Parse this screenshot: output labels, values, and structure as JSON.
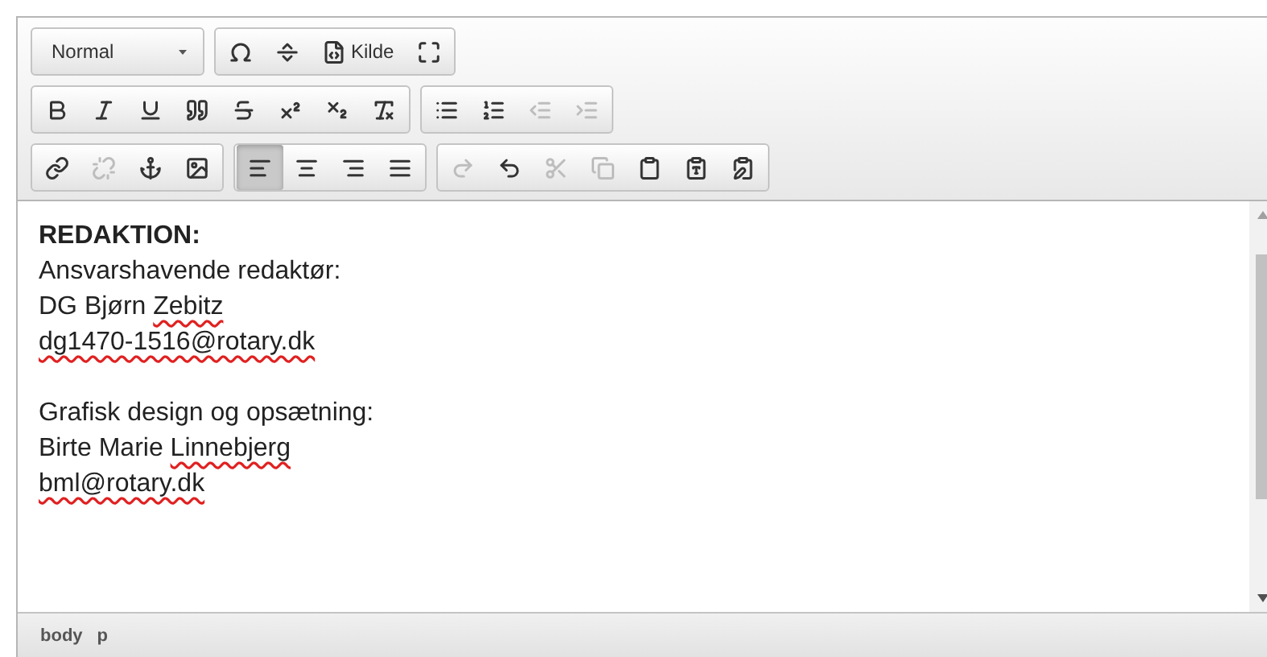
{
  "toolbar": {
    "rows": [
      [
        {
          "kind": "format",
          "label": "Normal"
        },
        {
          "buttons": [
            {
              "kind": "omega",
              "disabled": false
            },
            {
              "kind": "pagebreak",
              "disabled": false
            },
            {
              "kind": "source",
              "label": "Kilde",
              "disabled": false
            },
            {
              "kind": "maximize",
              "disabled": false
            }
          ]
        }
      ],
      [
        {
          "buttons": [
            {
              "kind": "bold",
              "disabled": false
            },
            {
              "kind": "italic",
              "disabled": false
            },
            {
              "kind": "underline",
              "disabled": false
            },
            {
              "kind": "quote",
              "disabled": false
            },
            {
              "kind": "strike",
              "disabled": false
            },
            {
              "kind": "superscript",
              "disabled": false
            },
            {
              "kind": "subscript",
              "disabled": false
            },
            {
              "kind": "removeformat",
              "disabled": false
            }
          ]
        },
        {
          "buttons": [
            {
              "kind": "bulletlist",
              "disabled": false
            },
            {
              "kind": "numberlist",
              "disabled": false
            },
            {
              "kind": "outdent",
              "disabled": true
            },
            {
              "kind": "indent",
              "disabled": true
            }
          ]
        }
      ],
      [
        {
          "buttons": [
            {
              "kind": "link",
              "disabled": false
            },
            {
              "kind": "unlink",
              "disabled": true
            },
            {
              "kind": "anchor",
              "disabled": false
            },
            {
              "kind": "image",
              "disabled": false
            }
          ]
        },
        {
          "buttons": [
            {
              "kind": "alignleft",
              "disabled": false,
              "selected": true
            },
            {
              "kind": "aligncenter",
              "disabled": false,
              "selected": false
            },
            {
              "kind": "alignright",
              "disabled": false,
              "selected": false
            },
            {
              "kind": "justify",
              "disabled": false,
              "selected": false
            }
          ]
        },
        {
          "buttons": [
            {
              "kind": "redo",
              "disabled": true
            },
            {
              "kind": "undo",
              "disabled": false
            },
            {
              "kind": "cut",
              "disabled": true
            },
            {
              "kind": "copy",
              "disabled": true
            },
            {
              "kind": "paste",
              "disabled": false
            },
            {
              "kind": "pastetext",
              "disabled": false
            },
            {
              "kind": "pasteword",
              "disabled": false
            }
          ]
        }
      ]
    ]
  },
  "content": {
    "paragraphs": [
      [
        [
          {
            "text": "REDAKTION:",
            "kind": "bold"
          }
        ],
        [
          {
            "text": "Ansvarshavende redaktør:",
            "kind": "plain"
          }
        ],
        [
          {
            "text": "DG Bjørn ",
            "kind": "plain"
          },
          {
            "text": "Zebitz",
            "kind": "plain",
            "misspelled": true
          }
        ],
        [
          {
            "text": "dg1470-1516@rotary.dk",
            "kind": "link",
            "misspelled": true
          }
        ]
      ],
      [
        [
          {
            "text": "Grafisk design og opsætning:",
            "kind": "plain"
          }
        ],
        [
          {
            "text": "Birte Marie ",
            "kind": "plain"
          },
          {
            "text": "Linnebjerg",
            "kind": "plain",
            "misspelled": true
          }
        ],
        [
          {
            "text": "bml@rotary.dk",
            "kind": "link",
            "misspelled": true
          }
        ]
      ]
    ]
  },
  "status_bar": {
    "path": [
      "body",
      "p"
    ]
  }
}
